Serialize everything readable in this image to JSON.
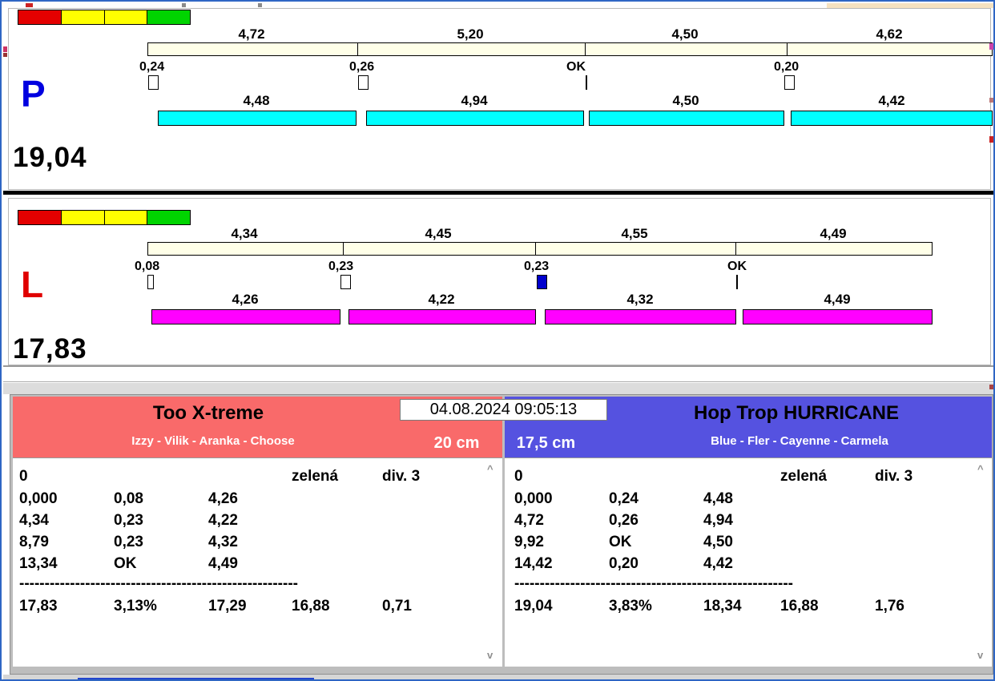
{
  "colors": {
    "frame": "#2f66c4",
    "cream": "#ffffe8",
    "cyan": "#00ffff",
    "magenta": "#ff00ff",
    "marker_blue": "#0000cc",
    "indicator": [
      "#e40000",
      "#ffff00",
      "#ffff00",
      "#00d400"
    ],
    "left_header": "#f96a6a",
    "right_header": "#5552e0",
    "lane_p_letter": "#0000e0",
    "lane_l_letter": "#e00000"
  },
  "timestamp": "04.08.2024 09:05:13",
  "lane_p": {
    "label": "P",
    "total": "19,04",
    "upper_splits": [
      "4,72",
      "5,20",
      "4,50",
      "4,62"
    ],
    "gaps": [
      "0,24",
      "0,26",
      "OK",
      "0,20"
    ],
    "lower_splits": [
      "4,48",
      "4,94",
      "4,50",
      "4,42"
    ]
  },
  "lane_l": {
    "label": "L",
    "total": "17,83",
    "upper_splits": [
      "4,34",
      "4,45",
      "4,55",
      "4,49"
    ],
    "gaps": [
      "0,08",
      "0,23",
      "0,23",
      "OK"
    ],
    "lower_splits": [
      "4,26",
      "4,22",
      "4,32",
      "4,49"
    ]
  },
  "left_team": {
    "name": "Too X-treme",
    "members": "Izzy - Vilik - Aranka - Choose",
    "height": "20 cm",
    "rows": [
      [
        "0",
        "",
        "",
        "zelená",
        "div. 3"
      ],
      [
        "0,000",
        "0,08",
        "4,26",
        "",
        ""
      ],
      [
        "4,34",
        "0,23",
        "4,22",
        "",
        ""
      ],
      [
        "8,79",
        "0,23",
        "4,32",
        "",
        ""
      ],
      [
        "13,34",
        "OK",
        "4,49",
        "",
        ""
      ],
      [
        "-------------------------------------------------------",
        "",
        "",
        "",
        ""
      ],
      [
        "17,83",
        "3,13%",
        "17,29",
        "16,88",
        "0,71"
      ]
    ]
  },
  "right_team": {
    "name": "Hop Trop HURRICANE",
    "members": "Blue - Fler - Cayenne - Carmela",
    "height": "17,5 cm",
    "rows": [
      [
        "0",
        "",
        "",
        "zelená",
        "div. 3"
      ],
      [
        "0,000",
        "0,24",
        "4,48",
        "",
        ""
      ],
      [
        "4,72",
        "0,26",
        "4,94",
        "",
        ""
      ],
      [
        "9,92",
        "OK",
        "4,50",
        "",
        ""
      ],
      [
        "14,42",
        "0,20",
        "4,42",
        "",
        ""
      ],
      [
        "-------------------------------------------------------",
        "",
        "",
        "",
        ""
      ],
      [
        "19,04",
        "3,83%",
        "18,34",
        "16,88",
        "1,76"
      ]
    ]
  },
  "scroll": {
    "up": "^",
    "down": "v"
  }
}
